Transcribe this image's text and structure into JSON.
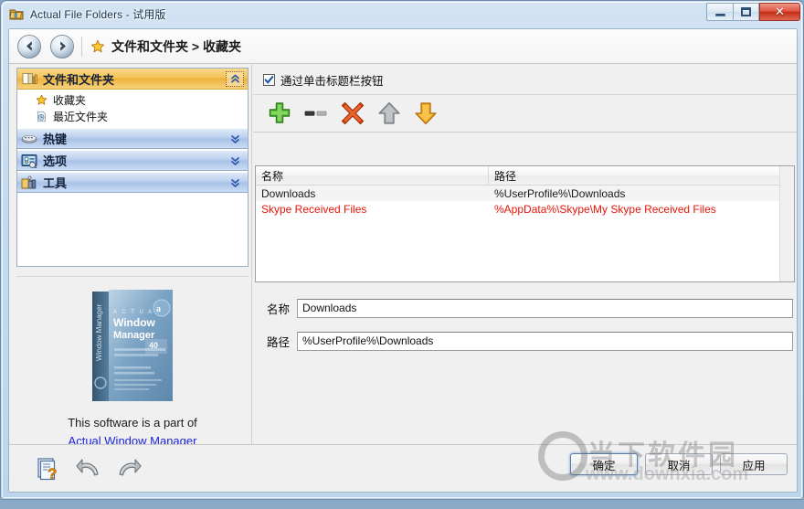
{
  "window": {
    "title": "Actual File Folders - 试用版",
    "icon": "folder-app-icon",
    "minimize_label": "",
    "maximize_label": "",
    "close_label": "✕"
  },
  "nav": {
    "back_icon": "arrow-left-icon",
    "forward_icon": "arrow-right-icon",
    "crumb_icon": "star-icon",
    "breadcrumb": "文件和文件夹 > 收藏夹"
  },
  "sidebar": {
    "groups": [
      {
        "label": "文件和文件夹",
        "icon": "folders-icon",
        "state": "active",
        "chevron": "chevron-up-icon",
        "items": [
          {
            "label": "收藏夹",
            "icon": "star-icon"
          },
          {
            "label": "最近文件夹",
            "icon": "recent-clock-icon"
          }
        ]
      },
      {
        "label": "热键",
        "icon": "keyboard-icon",
        "state": "inactive",
        "chevron": "chevron-down-icon",
        "items": []
      },
      {
        "label": "选项",
        "icon": "options-icon",
        "state": "inactive",
        "chevron": "chevron-down-icon",
        "items": []
      },
      {
        "label": "工具",
        "icon": "tools-icon",
        "state": "inactive",
        "chevron": "chevron-down-icon",
        "items": []
      }
    ],
    "promo": {
      "boxshot_alt": "Actual Window Manager box",
      "boxshot_title_small": "A C T U A L",
      "boxshot_title": "Window Manager",
      "text": "This software is a part of",
      "link": "Actual Window Manager"
    }
  },
  "main": {
    "checkbox": {
      "label": "通过单击标题栏按钮",
      "checked": true
    },
    "toolbar": [
      {
        "name": "add-button",
        "icon": "plus-green-icon",
        "enabled": true
      },
      {
        "name": "remove-button",
        "icon": "minus-gray-icon",
        "enabled": false
      },
      {
        "name": "delete-button",
        "icon": "cross-red-icon",
        "enabled": true
      },
      {
        "name": "move-up-button",
        "icon": "arrow-up-gray-icon",
        "enabled": false
      },
      {
        "name": "move-down-button",
        "icon": "arrow-down-orange-icon",
        "enabled": true
      }
    ],
    "list": {
      "columns": [
        "名称",
        "路径"
      ],
      "rows": [
        {
          "name": "Downloads",
          "path": "%UserProfile%\\Downloads",
          "color": "#1a1a1a",
          "selected": true
        },
        {
          "name": "Skype Received Files",
          "path": "%AppData%\\Skype\\My Skype Received Files",
          "color": "#e8140a",
          "selected": false
        }
      ]
    },
    "form": {
      "name_label": "名称",
      "name_value": "Downloads",
      "path_label": "路径",
      "path_value": "%UserProfile%\\Downloads"
    }
  },
  "bottom": {
    "help_icon": "help-document-icon",
    "undo_icon": "undo-arrow-icon",
    "redo_icon": "redo-arrow-icon",
    "buttons": [
      {
        "label": "确定",
        "name": "ok-button",
        "default": true
      },
      {
        "label": "取消",
        "name": "cancel-button",
        "default": false
      },
      {
        "label": "应用",
        "name": "apply-button",
        "default": false
      }
    ]
  },
  "watermark": {
    "chinese": "当下软件园",
    "url": "www.downxia.com"
  },
  "colors": {
    "accent_gold": "#efb33c",
    "accent_blue": "#a8c2e8",
    "error_red": "#e8140a",
    "link_blue": "#1a25d8"
  }
}
